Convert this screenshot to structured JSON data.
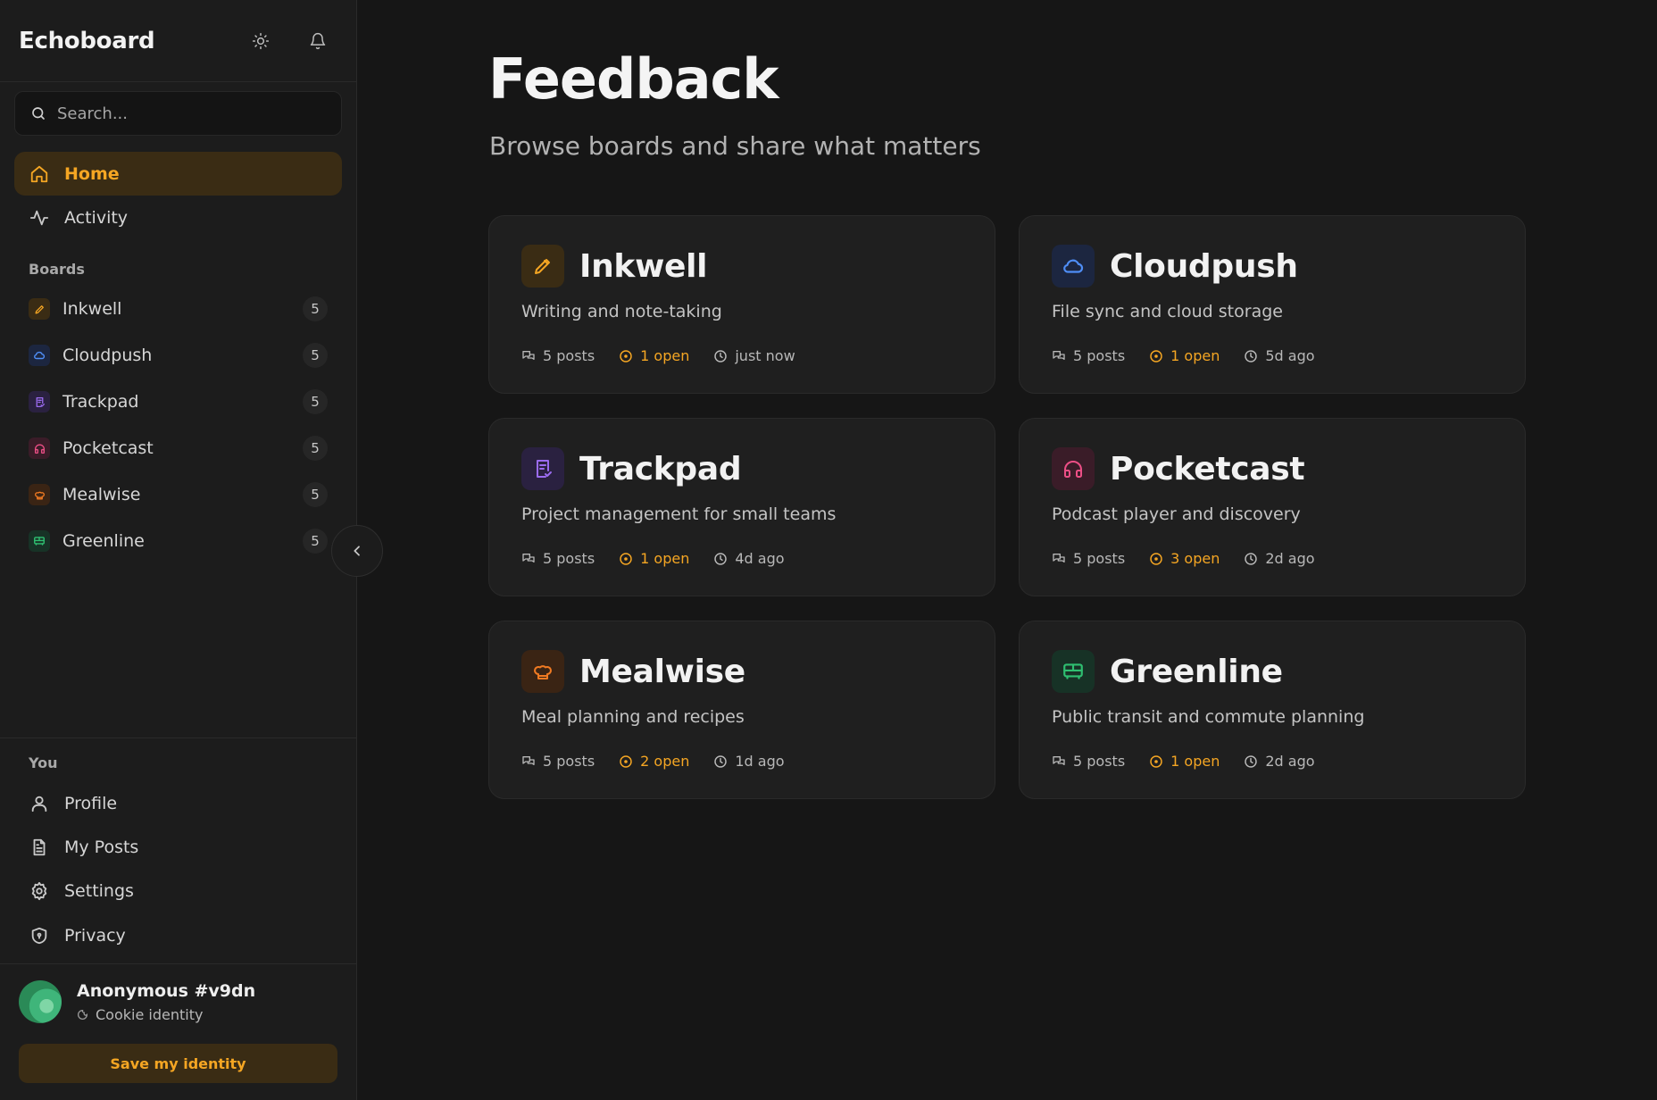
{
  "app": {
    "title": "Echoboard"
  },
  "search": {
    "placeholder": "Search..."
  },
  "nav": [
    {
      "label": "Home",
      "icon": "home-icon",
      "active": true
    },
    {
      "label": "Activity",
      "icon": "activity-icon",
      "active": false
    }
  ],
  "sidebar_boards": {
    "label": "Boards",
    "items": [
      {
        "label": "Inkwell",
        "count": "5",
        "icon": "pencil-icon",
        "color": "#f5a623"
      },
      {
        "label": "Cloudpush",
        "count": "5",
        "icon": "cloud-icon",
        "color": "#4f8ef7"
      },
      {
        "label": "Trackpad",
        "count": "5",
        "icon": "clipboard-check-icon",
        "color": "#9b6cf0"
      },
      {
        "label": "Pocketcast",
        "count": "5",
        "icon": "headphones-icon",
        "color": "#ec4f86"
      },
      {
        "label": "Mealwise",
        "count": "5",
        "icon": "chef-hat-icon",
        "color": "#f07a22"
      },
      {
        "label": "Greenline",
        "count": "5",
        "icon": "bus-icon",
        "color": "#2fbf71"
      }
    ]
  },
  "you": {
    "label": "You",
    "items": [
      {
        "label": "Profile",
        "icon": "user-icon"
      },
      {
        "label": "My Posts",
        "icon": "file-text-icon"
      },
      {
        "label": "Settings",
        "icon": "gear-icon"
      },
      {
        "label": "Privacy",
        "icon": "shield-icon"
      }
    ]
  },
  "user": {
    "name": "Anonymous #v9dn",
    "identity": "Cookie identity",
    "save_label": "Save my identity"
  },
  "main": {
    "title": "Feedback",
    "subtitle": "Browse boards and share what matters"
  },
  "boards": [
    {
      "name": "Inkwell",
      "desc": "Writing and note-taking",
      "posts": "5 posts",
      "open": "1 open",
      "time": "just now",
      "icon": "pencil-icon",
      "color": "#f5a623",
      "bg": "#3a2c14"
    },
    {
      "name": "Cloudpush",
      "desc": "File sync and cloud storage",
      "posts": "5 posts",
      "open": "1 open",
      "time": "5d ago",
      "icon": "cloud-icon",
      "color": "#4f8ef7",
      "bg": "#1c2640"
    },
    {
      "name": "Trackpad",
      "desc": "Project management for small teams",
      "posts": "5 posts",
      "open": "1 open",
      "time": "4d ago",
      "icon": "clipboard-check-icon",
      "color": "#9b6cf0",
      "bg": "#2a2140"
    },
    {
      "name": "Pocketcast",
      "desc": "Podcast player and discovery",
      "posts": "5 posts",
      "open": "3 open",
      "time": "2d ago",
      "icon": "headphones-icon",
      "color": "#ec4f86",
      "bg": "#3a1c28"
    },
    {
      "name": "Mealwise",
      "desc": "Meal planning and recipes",
      "posts": "5 posts",
      "open": "2 open",
      "time": "1d ago",
      "icon": "chef-hat-icon",
      "color": "#f07a22",
      "bg": "#3a2414"
    },
    {
      "name": "Greenline",
      "desc": "Public transit and commute planning",
      "posts": "5 posts",
      "open": "1 open",
      "time": "2d ago",
      "icon": "bus-icon",
      "color": "#2fbf71",
      "bg": "#173226"
    }
  ]
}
